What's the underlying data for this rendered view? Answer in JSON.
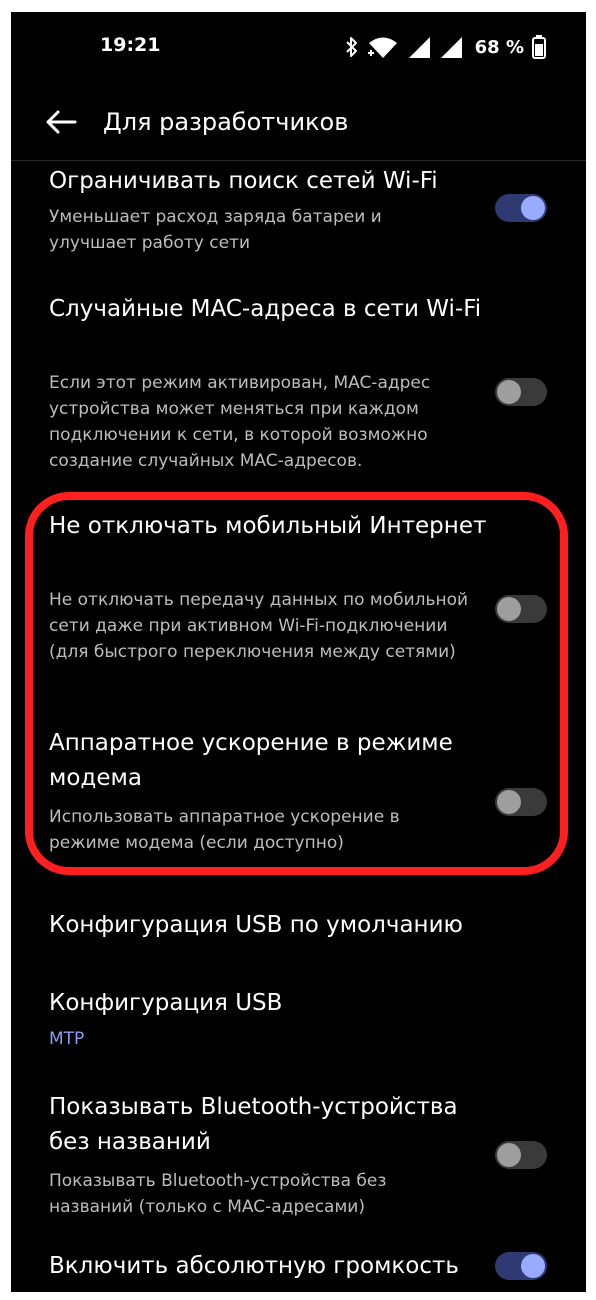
{
  "status_bar": {
    "time": "19:21",
    "battery": "68 %",
    "icons": [
      "bluetooth-icon",
      "wifi-icon",
      "signal-icon",
      "signal-icon",
      "battery-icon"
    ]
  },
  "header": {
    "title": "Для разработчиков",
    "back_icon": "arrow-left-icon"
  },
  "settings": [
    {
      "title": "Ограничивать поиск сетей Wi-Fi",
      "description": "Уменьшает расход заряда батареи и улучшает работу сети",
      "toggle": true
    },
    {
      "title": "Случайные MAC-адреса в сети Wi-Fi",
      "description": "Если этот режим активирован, MAC-адрес устройства может меняться при каждом подключении к сети, в которой возможно создание случайных MAC-адресов.",
      "toggle": false
    },
    {
      "title": "Не отключать мобильный Интернет",
      "description": "Не отключать передачу данных по мобильной сети даже при активном Wi-Fi-подключении (для быстрого переключения между сетями)",
      "toggle": false
    },
    {
      "title": "Аппаратное ускорение в режиме модема",
      "description": "Использовать аппаратное ускорение в режиме модема (если доступно)",
      "toggle": false
    },
    {
      "title": "Конфигурация USB по умолчанию"
    },
    {
      "title": "Конфигурация USB",
      "value": "MTP"
    },
    {
      "title": "Показывать Bluetooth-устройства без названий",
      "description": "Показывать Bluetooth-устройства без названий (только с MAC-адресами)",
      "toggle": false
    },
    {
      "title": "Включить абсолютную громкость",
      "toggle": true
    }
  ],
  "colors": {
    "background": "#000000",
    "accent": "#98acff",
    "highlight": "#ff1f1f",
    "toggle_off_track": "#3a3a3a",
    "toggle_on_track": "#2f3a73"
  }
}
